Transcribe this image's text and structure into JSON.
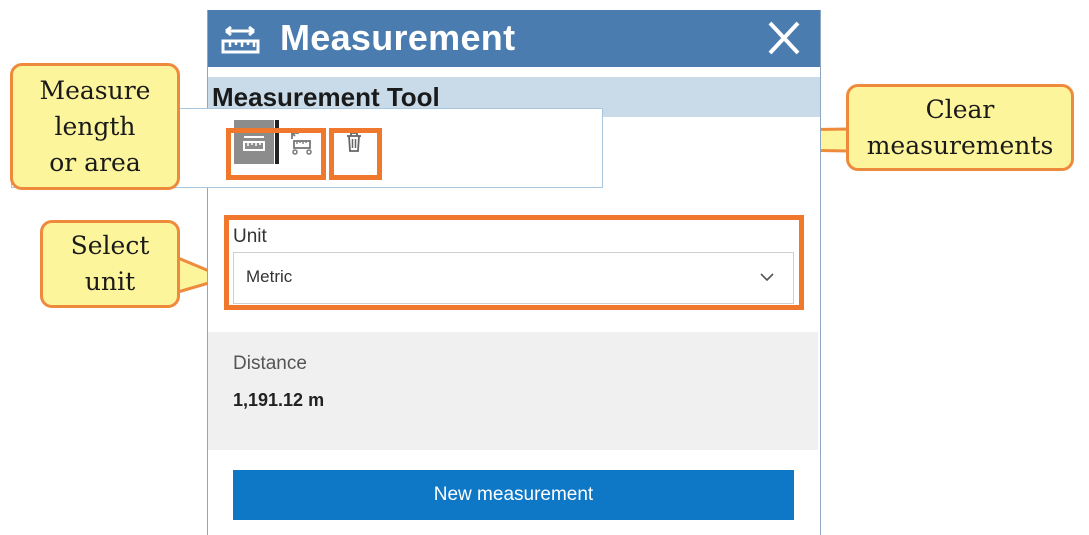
{
  "widget": {
    "title": "Measurement",
    "tool_header": "Measurement Tool",
    "tools": [
      {
        "name": "distance",
        "icon": "measure-distance-icon",
        "active": true
      },
      {
        "name": "area",
        "icon": "measure-area-icon",
        "active": false
      },
      {
        "name": "clear",
        "icon": "trash-icon",
        "active": false
      }
    ],
    "unit": {
      "label": "Unit",
      "selected": "Metric"
    },
    "result": {
      "label": "Distance",
      "value": "1,191.12 m"
    },
    "new_measurement_label": "New measurement"
  },
  "callouts": {
    "measure": [
      "Measure",
      "length",
      "or area"
    ],
    "clear": [
      "Clear",
      "measurements"
    ],
    "unit": [
      "Select",
      "unit"
    ]
  },
  "colors": {
    "titlebar": "#4a7cb0",
    "header": "#c9dbe8",
    "highlight": "#f0782c",
    "callout_fill": "#fdf59c",
    "callout_border": "#ee8a3c",
    "button": "#0e78c6"
  }
}
